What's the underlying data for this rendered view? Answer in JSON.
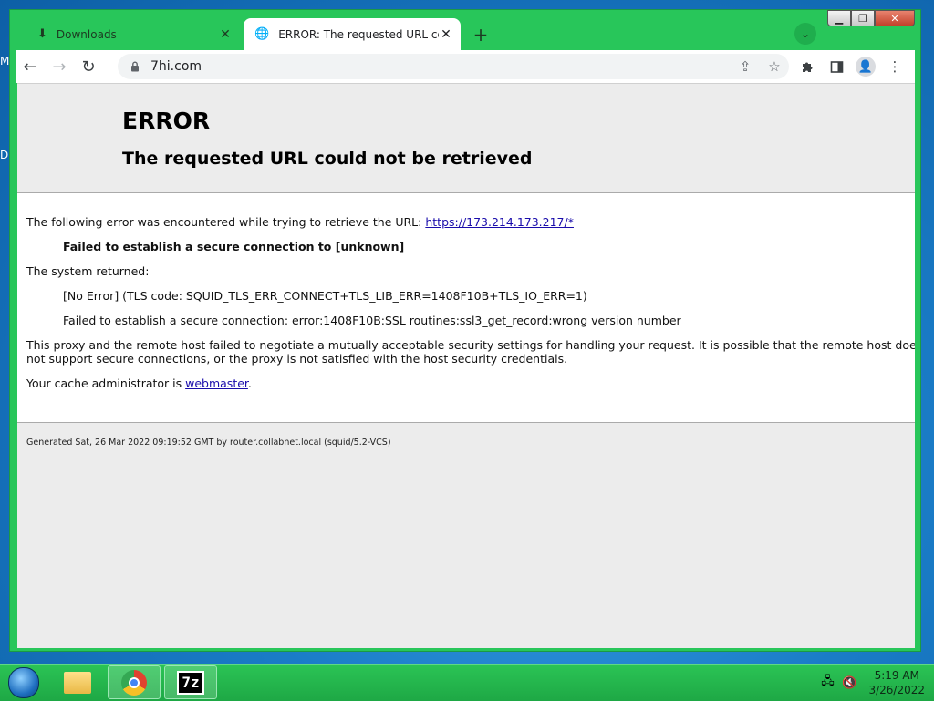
{
  "desktop": {
    "edge_text_1": "M",
    "edge_text_2": "D"
  },
  "browser": {
    "tabs": [
      {
        "title": "Downloads",
        "icon": "download-icon",
        "active": false
      },
      {
        "title": "ERROR: The requested URL could not be retrieved",
        "icon": "globe-icon",
        "active": true
      }
    ],
    "address": "7hi.com"
  },
  "page": {
    "title": "ERROR",
    "subtitle": "The requested URL could not be retrieved",
    "intro": "The following error was encountered while trying to retrieve the URL: ",
    "url_link": "https://173.214.173.217/*",
    "failed_secure": "Failed to establish a secure connection to [unknown]",
    "system_returned": "The system returned:",
    "no_error": "[No Error] (TLS code: SQUID_TLS_ERR_CONNECT+TLS_LIB_ERR=1408F10B+TLS_IO_ERR=1)",
    "ssl_error": "Failed to establish a secure connection: error:1408F10B:SSL routines:ssl3_get_record:wrong version number",
    "proxy_line1": "This proxy and the remote host failed to negotiate a mutually acceptable security settings for handling your request. It is possible that the remote host does",
    "proxy_line2": "not support secure connections, or the proxy is not satisfied with the host security credentials.",
    "admin_prefix": "Your cache administrator is ",
    "admin_link": "webmaster",
    "admin_suffix": ".",
    "footer": "Generated Sat, 26 Mar 2022 09:19:52 GMT by router.collabnet.local (squid/5.2-VCS)"
  },
  "taskbar": {
    "items": [
      "start-orb",
      "file-explorer",
      "google-chrome",
      "7-zip"
    ],
    "time": "5:19 AM",
    "date": "3/26/2022"
  }
}
